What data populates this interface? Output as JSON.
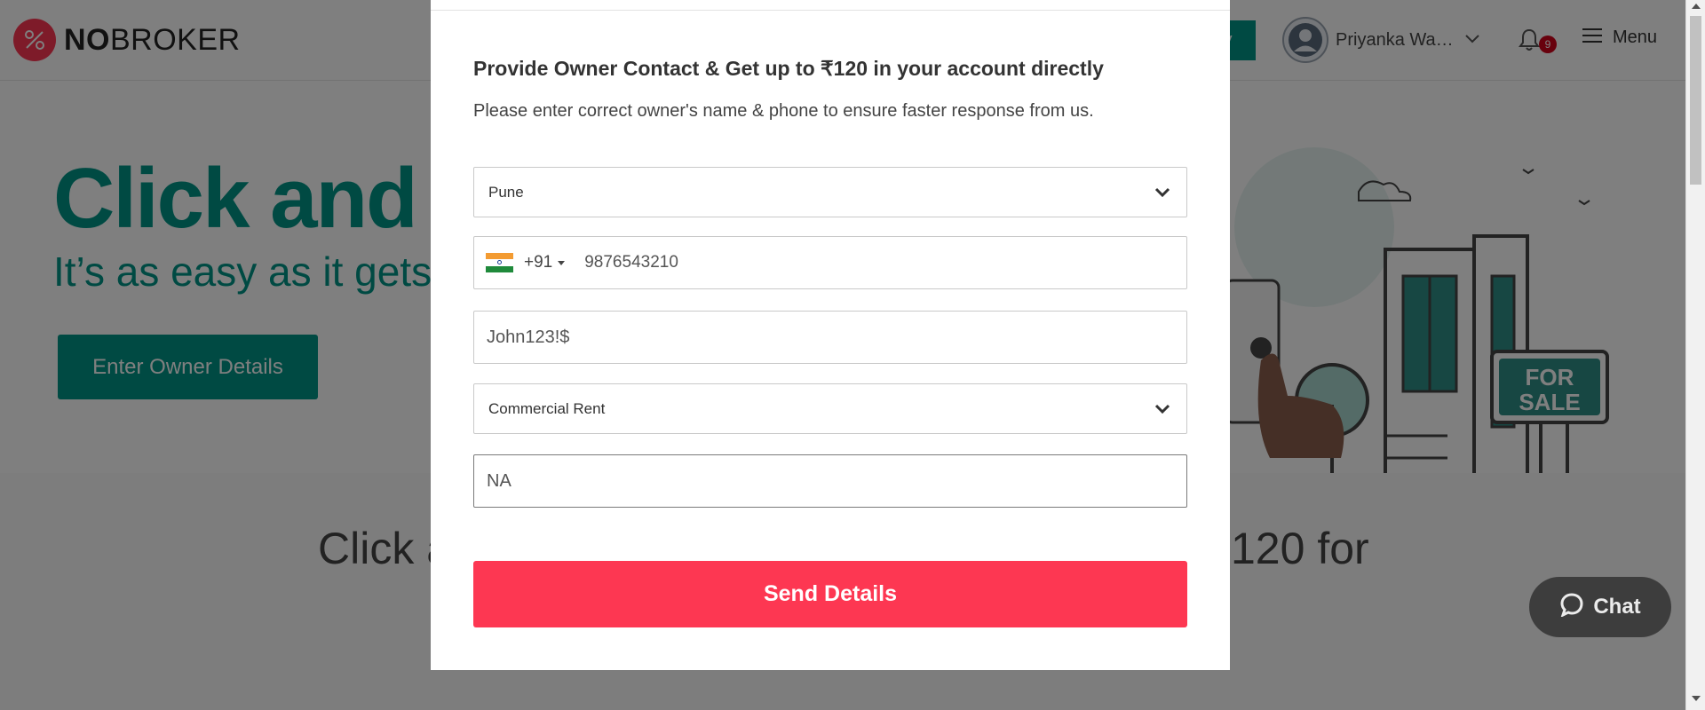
{
  "header": {
    "logo_bold": "NO",
    "logo_rest": "BROKER",
    "post_property_partial": "ty",
    "user_name": "Priyanka Wad...",
    "notification_count": "9",
    "menu_label": "Menu"
  },
  "hero": {
    "title": "Click and E",
    "subtitle": "It’s as easy as it gets",
    "owner_button": "Enter Owner Details",
    "illustration_sign": [
      "FOR",
      "SALE"
    ]
  },
  "promo": {
    "left_text": "Click a",
    "right_text": "120 for"
  },
  "chat": {
    "label": "Chat"
  },
  "modal": {
    "title": "Provide Owner Contact & Get up to ₹120 in your account directly",
    "subtitle": "Please enter correct owner's name & phone to ensure faster response from us.",
    "city_select": "Pune",
    "phone_code": "+91",
    "phone_value": "9876543210",
    "owner_name_value": "John123!$",
    "property_type_select": "Commercial Rent",
    "details_value": "NA",
    "send_button": "Send Details"
  },
  "colors": {
    "brand_red": "#fd3752",
    "brand_teal": "#009587",
    "overlay": "rgba(0,0,0,0.5)"
  },
  "icons": [
    "logo-icon",
    "user-avatar-icon",
    "chevron-down-icon",
    "bell-icon",
    "hamburger-icon",
    "india-flag-icon",
    "chat-icon"
  ]
}
